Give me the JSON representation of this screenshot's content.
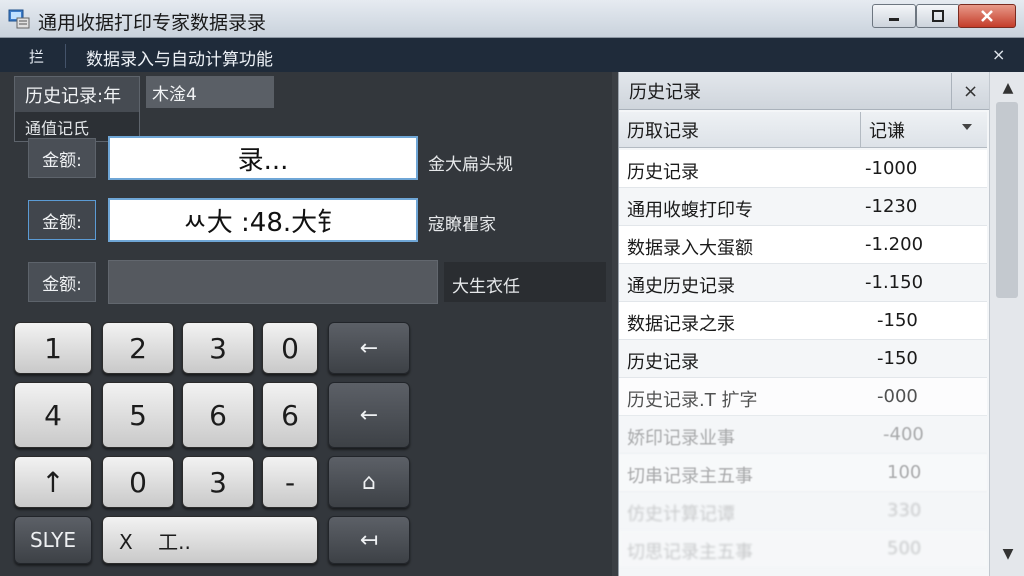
{
  "window": {
    "title": "通用收据打印专家数据录录"
  },
  "menubar": {
    "logo": "拦",
    "title": "数据录入与自动计算功能",
    "close": "×"
  },
  "left": {
    "history_tab": "历史记录:年",
    "tab_dropdown": "通值记氏",
    "mode_field": "木淦4",
    "fields": [
      {
        "label": "金额:",
        "value": "录...",
        "note": "金大扁头规"
      },
      {
        "label": "金额:",
        "value": "ㅆ大 :48.大钅",
        "note": "寇瞭瞿家"
      },
      {
        "label": "金额:",
        "value": "",
        "note": "大生衣任"
      }
    ]
  },
  "keypad": {
    "row1": [
      "1",
      "2",
      "3",
      "0",
      "←"
    ],
    "row2": [
      "4",
      "5",
      "6",
      "6",
      "←"
    ],
    "row3": [
      "↑",
      "0",
      "3",
      "-",
      "⌂"
    ],
    "row4": [
      "SLYE",
      "X    工..",
      "↤"
    ]
  },
  "history": {
    "title": "历史记录",
    "close": "×",
    "col1": "历取记录",
    "col2": "记谦",
    "rows": [
      {
        "name": "历史记录",
        "value": "-1000"
      },
      {
        "name": "通用收蝮打印专",
        "value": "-1230"
      },
      {
        "name": "数据录入大蛋额",
        "value": "-1.200"
      },
      {
        "name": "通史历史记录",
        "value": "-1.150"
      },
      {
        "name": "数据记录之汞",
        "value": "-150"
      },
      {
        "name": "历史记录",
        "value": "-150"
      },
      {
        "name": "历史记录.T 扩字",
        "value": "-000"
      },
      {
        "name": "娇印记录业事",
        "value": "-400"
      },
      {
        "name": "切串记录主五事",
        "value": "100"
      },
      {
        "name": "仿史计算记谭",
        "value": "330"
      },
      {
        "name": "切思记录主五事",
        "value": "500"
      }
    ]
  },
  "colors": {
    "titlebar": "#d6dde5",
    "menubar": "#1f2b3a",
    "left_panel": "#33373c",
    "close_button": "#c43d2a",
    "input_border": "#6fa6d6"
  }
}
